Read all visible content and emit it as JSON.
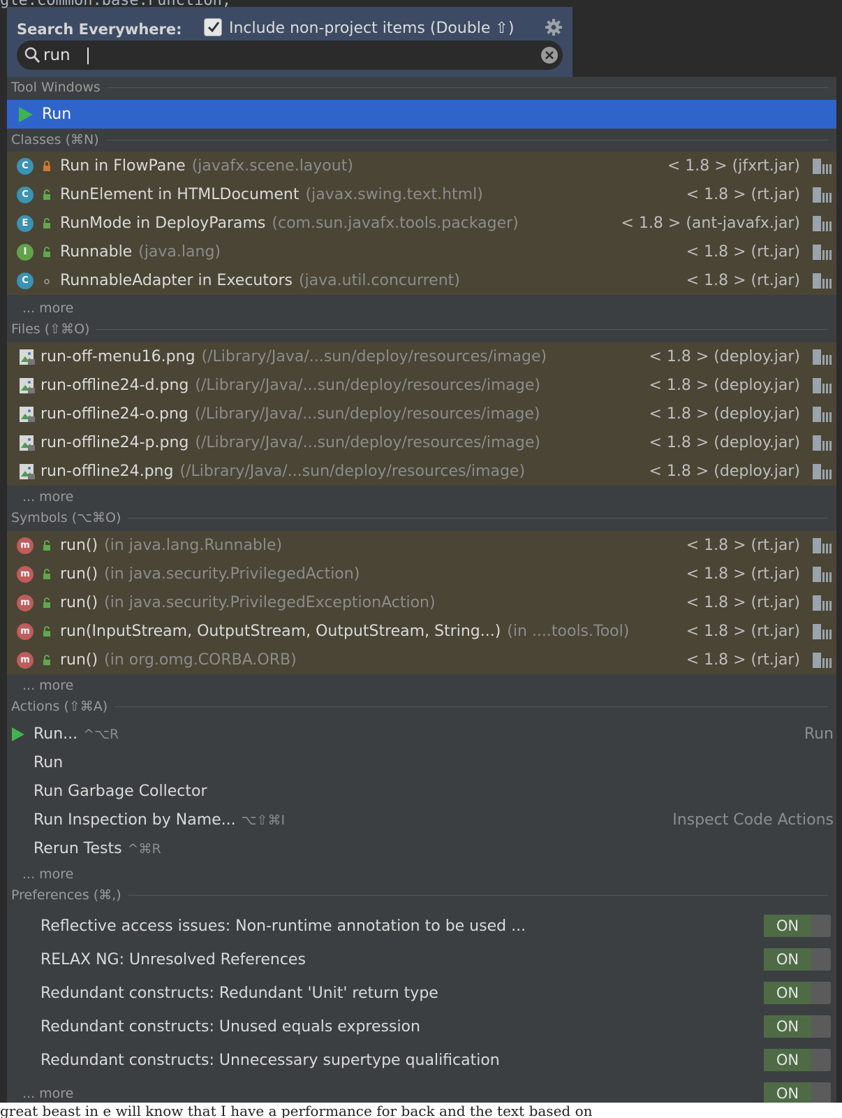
{
  "header": {
    "title": "Search Everywhere:",
    "include_label": "Include non-project items (Double ⇧)",
    "include_checked": true
  },
  "search": {
    "value": "run",
    "placeholder": ""
  },
  "sections": {
    "tool_windows": "Tool Windows",
    "classes": "Classes (⌘N)",
    "files": "Files (⇧⌘O)",
    "symbols": "Symbols (⌥⌘O)",
    "actions": "Actions (⇧⌘A)",
    "preferences": "Preferences (⌘,)"
  },
  "more_label": "... more",
  "tool_windows": [
    {
      "label": "Run",
      "icon": "run-icon"
    }
  ],
  "classes": [
    {
      "badge": "C",
      "name": "Run in FlowPane",
      "ctx": "(javafx.scene.layout)",
      "lib": "< 1.8 > (jfxrt.jar)"
    },
    {
      "badge": "C",
      "name": "RunElement in HTMLDocument",
      "ctx": "(javax.swing.text.html)",
      "lib": "< 1.8 > (rt.jar)"
    },
    {
      "badge": "E",
      "name": "RunMode in DeployParams",
      "ctx": "(com.sun.javafx.tools.packager)",
      "lib": "< 1.8 > (ant-javafx.jar)"
    },
    {
      "badge": "I",
      "name": "Runnable",
      "ctx": "(java.lang)",
      "lib": "< 1.8 > (rt.jar)"
    },
    {
      "badge": "C",
      "name": "RunnableAdapter in Executors",
      "ctx": "(java.util.concurrent)",
      "lib": "< 1.8 > (rt.jar)"
    }
  ],
  "files": [
    {
      "name": "run-off-menu16.png",
      "ctx": "(/Library/Java/...sun/deploy/resources/image)",
      "lib": "< 1.8 > (deploy.jar)"
    },
    {
      "name": "run-offline24-d.png",
      "ctx": "(/Library/Java/...sun/deploy/resources/image)",
      "lib": "< 1.8 > (deploy.jar)"
    },
    {
      "name": "run-offline24-o.png",
      "ctx": "(/Library/Java/...sun/deploy/resources/image)",
      "lib": "< 1.8 > (deploy.jar)"
    },
    {
      "name": "run-offline24-p.png",
      "ctx": "(/Library/Java/...sun/deploy/resources/image)",
      "lib": "< 1.8 > (deploy.jar)"
    },
    {
      "name": "run-offline24.png",
      "ctx": "(/Library/Java/...sun/deploy/resources/image)",
      "lib": "< 1.8 > (deploy.jar)"
    }
  ],
  "symbols": [
    {
      "badge": "m",
      "name": "run()",
      "ctx": "(in java.lang.Runnable)",
      "lib": "< 1.8 > (rt.jar)"
    },
    {
      "badge": "m",
      "name": "run()",
      "ctx": "(in java.security.PrivilegedAction)",
      "lib": "< 1.8 > (rt.jar)"
    },
    {
      "badge": "m",
      "name": "run()",
      "ctx": "(in java.security.PrivilegedExceptionAction)",
      "lib": "< 1.8 > (rt.jar)"
    },
    {
      "badge": "m",
      "name": "run(InputStream, OutputStream, OutputStream, String...)",
      "ctx": "(in ....tools.Tool)",
      "lib": "< 1.8 > (rt.jar)"
    },
    {
      "badge": "m",
      "name": "run()",
      "ctx": "(in org.omg.CORBA.ORB)",
      "lib": "< 1.8 > (rt.jar)"
    }
  ],
  "actions": [
    {
      "name": "Run...",
      "shortcut": "^⌥R",
      "hint": "Run"
    },
    {
      "name": "Run",
      "shortcut": "",
      "hint": ""
    },
    {
      "name": "Run Garbage Collector",
      "shortcut": "",
      "hint": ""
    },
    {
      "name": "Run Inspection by Name...",
      "shortcut": "⌥⇧⌘I",
      "hint": "Inspect Code Actions"
    },
    {
      "name": "Rerun Tests",
      "shortcut": "^⌘R",
      "hint": ""
    }
  ],
  "preferences": [
    {
      "name": "Reflective access issues: Non-runtime annotation to be used ...",
      "state": "ON"
    },
    {
      "name": "RELAX NG: Unresolved References",
      "state": "ON"
    },
    {
      "name": "Redundant constructs: Redundant 'Unit' return type",
      "state": "ON"
    },
    {
      "name": "Redundant constructs: Unused equals expression",
      "state": "ON"
    },
    {
      "name": "Redundant constructs: Unnecessary supertype qualification",
      "state": "ON"
    }
  ],
  "last_toggle_state": "ON",
  "editor_top_line": "gle.common.base.Function;",
  "bottom_text": "great beast in e will know that I have a performance for back and the text based on",
  "colors": {
    "selected_row": "#2f65ca",
    "tinted_row": "#4a4535",
    "panel": "#3c3f41",
    "header": "#3c4b63",
    "toggle_on": "#4e6b46",
    "run_green": "#3fb34f"
  }
}
